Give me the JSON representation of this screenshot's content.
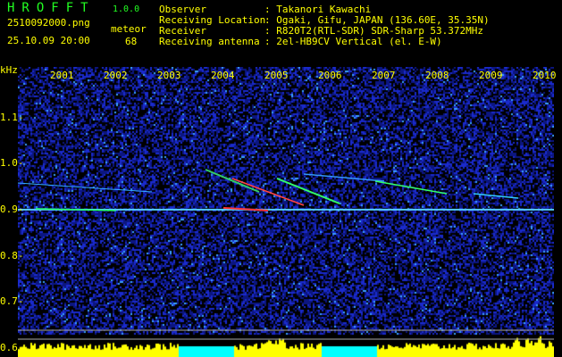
{
  "header": {
    "app_title": "HROFFT",
    "version": "1.0.0",
    "filename": "2510092000.png",
    "datetime": "25.10.09 20:00",
    "meteor_label": "meteor",
    "meteor_count": "68",
    "info": [
      {
        "label": "Observer",
        "value": "Takanori Kawachi"
      },
      {
        "label": "Receiving Location",
        "value": "Ogaki, Gifu, JAPAN (136.60E, 35.35N)"
      },
      {
        "label": "Receiver",
        "value": "R820T2(RTL-SDR) SDR-Sharp 53.372MHz"
      },
      {
        "label": "Receiving antenna",
        "value": "2el-HB9CV Vertical (el. E-W)"
      }
    ]
  },
  "chart_data": {
    "type": "heatmap",
    "ylabel": "kHz",
    "ylim": [
      0.58,
      1.21
    ],
    "y_ticks": [
      "1.1",
      "1.0",
      "0.9",
      "0.8",
      "0.7",
      "0.6"
    ],
    "x_ticks": [
      "2001",
      "2002",
      "2003",
      "2004",
      "2005",
      "2006",
      "2007",
      "2008",
      "2009",
      "2010"
    ],
    "carrier_khz": 0.9,
    "colors": {
      "background": "#000000",
      "noise": "#1a2acc",
      "text": "#ffff00",
      "title": "#22ff22",
      "level_high": "#ffff00",
      "level_low": "#00ffff"
    }
  }
}
